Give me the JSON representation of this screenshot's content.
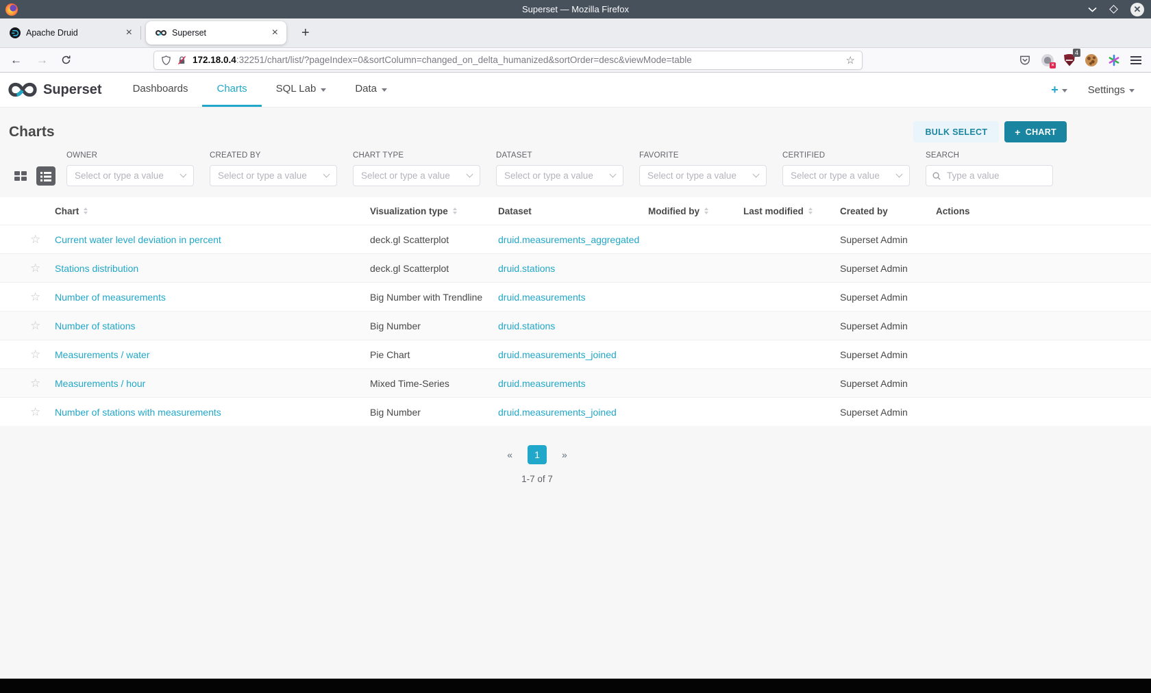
{
  "window": {
    "title": "Superset — Mozilla Firefox"
  },
  "browser": {
    "tabs": [
      {
        "title": "Apache Druid",
        "close_label": "×",
        "active": false
      },
      {
        "title": "Superset",
        "close_label": "×",
        "active": true
      }
    ],
    "new_tab_label": "+",
    "address": {
      "host": "172.18.0.4",
      "path": ":32251/chart/list/?pageIndex=0&sortColumn=changed_on_delta_humanized&sortOrder=desc&viewMode=table"
    },
    "blocker_badge": "4"
  },
  "navbar": {
    "brand": "Superset",
    "items": [
      {
        "label": "Dashboards",
        "active": false,
        "caret": false
      },
      {
        "label": "Charts",
        "active": true,
        "caret": false
      },
      {
        "label": "SQL Lab",
        "active": false,
        "caret": true
      },
      {
        "label": "Data",
        "active": false,
        "caret": true
      }
    ],
    "plus_label": "+",
    "settings_label": "Settings"
  },
  "page": {
    "title": "Charts",
    "bulk_select_label": "BULK SELECT",
    "add_chart": {
      "plus": "+",
      "label": "CHART"
    }
  },
  "filters": [
    {
      "label": "OWNER",
      "placeholder": "Select or type a value"
    },
    {
      "label": "CREATED BY",
      "placeholder": "Select or type a value"
    },
    {
      "label": "CHART TYPE",
      "placeholder": "Select or type a value"
    },
    {
      "label": "DATASET",
      "placeholder": "Select or type a value"
    },
    {
      "label": "FAVORITE",
      "placeholder": "Select or type a value"
    },
    {
      "label": "CERTIFIED",
      "placeholder": "Select or type a value"
    }
  ],
  "search": {
    "label": "SEARCH",
    "placeholder": "Type a value"
  },
  "table": {
    "columns": [
      {
        "label": "Chart",
        "sortable": true
      },
      {
        "label": "Visualization type",
        "sortable": true
      },
      {
        "label": "Dataset",
        "sortable": false
      },
      {
        "label": "Modified by",
        "sortable": true
      },
      {
        "label": "Last modified",
        "sortable": true
      },
      {
        "label": "Created by",
        "sortable": false
      },
      {
        "label": "Actions",
        "sortable": false
      }
    ],
    "rows": [
      {
        "chart": "Current water level deviation in percent",
        "visualization_type": "deck.gl Scatterplot",
        "dataset": "druid.measurements_aggregated",
        "modified_by": "",
        "last_modified": "",
        "created_by": "Superset Admin",
        "actions": ""
      },
      {
        "chart": "Stations distribution",
        "visualization_type": "deck.gl Scatterplot",
        "dataset": "druid.stations",
        "modified_by": "",
        "last_modified": "",
        "created_by": "Superset Admin",
        "actions": ""
      },
      {
        "chart": "Number of measurements",
        "visualization_type": "Big Number with Trendline",
        "dataset": "druid.measurements",
        "modified_by": "",
        "last_modified": "",
        "created_by": "Superset Admin",
        "actions": ""
      },
      {
        "chart": "Number of stations",
        "visualization_type": "Big Number",
        "dataset": "druid.stations",
        "modified_by": "",
        "last_modified": "",
        "created_by": "Superset Admin",
        "actions": ""
      },
      {
        "chart": "Measurements / water",
        "visualization_type": "Pie Chart",
        "dataset": "druid.measurements_joined",
        "modified_by": "",
        "last_modified": "",
        "created_by": "Superset Admin",
        "actions": ""
      },
      {
        "chart": "Measurements / hour",
        "visualization_type": "Mixed Time-Series",
        "dataset": "druid.measurements",
        "modified_by": "",
        "last_modified": "",
        "created_by": "Superset Admin",
        "actions": ""
      },
      {
        "chart": "Number of stations with measurements",
        "visualization_type": "Big Number",
        "dataset": "druid.measurements_joined",
        "modified_by": "",
        "last_modified": "",
        "created_by": "Superset Admin",
        "actions": ""
      }
    ]
  },
  "pagination": {
    "prev_label": "«",
    "pages": [
      {
        "label": "1",
        "active": true
      }
    ],
    "next_label": "»",
    "summary": "1-7 of 7"
  },
  "icons": {
    "favorite_star": "☆",
    "url_bookmark_star": "☆"
  },
  "colors": {
    "accent": "#20a7c9",
    "accent_dark": "#1a85a0",
    "titlebar": "#47515b",
    "link": "#20a7c9",
    "blocker_shield": "#7c2230"
  }
}
